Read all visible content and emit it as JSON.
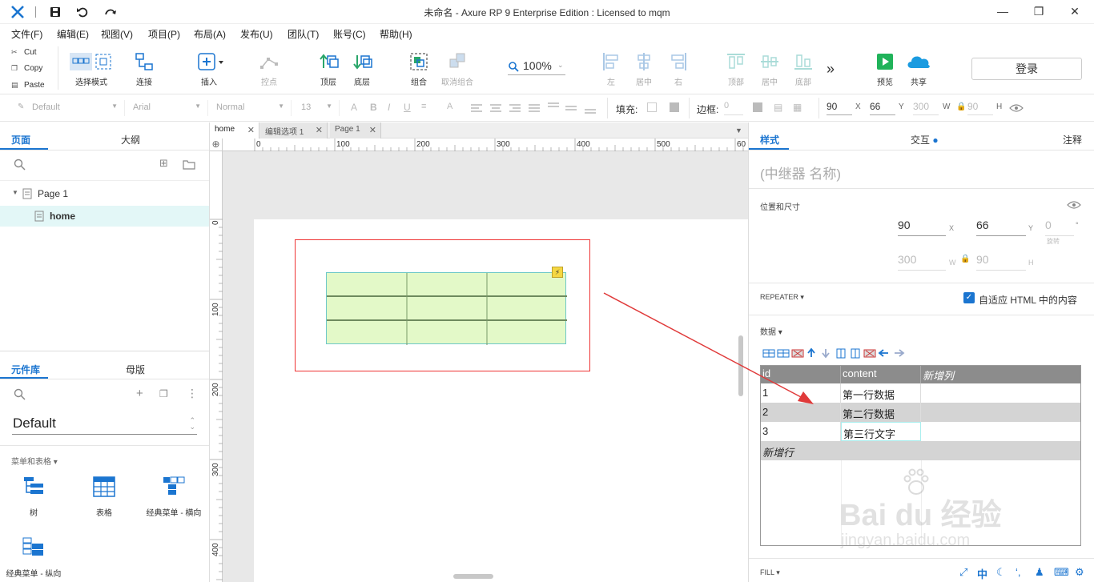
{
  "window": {
    "title": "未命名 - Axure RP 9 Enterprise Edition : Licensed to mqm"
  },
  "menu": [
    "文件(F)",
    "编辑(E)",
    "视图(V)",
    "项目(P)",
    "布局(A)",
    "发布(U)",
    "团队(T)",
    "账号(C)",
    "帮助(H)"
  ],
  "clipboard": {
    "cut": "Cut",
    "copy": "Copy",
    "paste": "Paste"
  },
  "toolbar": {
    "select_mode": "选择模式",
    "connect": "连接",
    "insert": "插入",
    "point": "控点",
    "top": "顶层",
    "bottom": "底层",
    "group": "组合",
    "ungroup": "取消组合",
    "zoom": "100%",
    "align_left": "左",
    "align_center": "居中",
    "align_right": "右",
    "align_top": "顶部",
    "align_middle": "居中",
    "align_bottom": "底部",
    "more": "»",
    "preview": "预览",
    "share": "共享",
    "login": "登录"
  },
  "format": {
    "style": "Default",
    "font": "Arial",
    "weight": "Normal",
    "size": "13",
    "fill_label": "填充:",
    "border_label": "边框:",
    "border_value": "0",
    "x": "90",
    "y": "66",
    "w": "300",
    "h": "90",
    "x_unit": "X",
    "y_unit": "Y",
    "w_unit": "W",
    "h_unit": "H"
  },
  "pages_panel": {
    "tab_pages": "页面",
    "tab_outline": "大纲",
    "page1": "Page 1",
    "home": "home"
  },
  "library_panel": {
    "tab_library": "元件库",
    "tab_masters": "母版",
    "library_select": "Default",
    "section": "菜单和表格",
    "items": [
      "树",
      "表格",
      "经典菜单 - 横向",
      "经典菜单 - 纵向"
    ]
  },
  "doc_tabs": [
    "home",
    "编辑选项 1",
    "Page 1"
  ],
  "ruler": {
    "h_ticks": [
      "0",
      "100",
      "200",
      "300",
      "400",
      "500",
      "60"
    ],
    "v_ticks": [
      "0",
      "100",
      "200",
      "300",
      "400"
    ]
  },
  "right_panel": {
    "tab_style": "样式",
    "tab_interactions": "交互",
    "tab_notes": "注释",
    "name_placeholder": "(中继器 名称)",
    "position_section": "位置和尺寸",
    "x": "90",
    "y": "66",
    "rotation": "0",
    "rotation_label": "旋转",
    "w": "300",
    "h": "90",
    "unit_x": "X",
    "unit_y": "Y",
    "unit_w": "W",
    "unit_h": "H",
    "degree": "°",
    "repeater_section": "REPEATER",
    "fit_html": "自适应 HTML 中的内容",
    "fit_html_checked": true,
    "data_section": "数据",
    "fill_section": "FILL",
    "accent_color": "#1b75d0"
  },
  "repeater_grid": {
    "headers": [
      "id",
      "content",
      "新增列"
    ],
    "rows": [
      [
        "1",
        "第一行数据"
      ],
      [
        "2",
        "第二行数据"
      ],
      [
        "3",
        "第三行文字"
      ]
    ],
    "new_row": "新增行"
  },
  "watermark": {
    "brand": "Bai du 经验",
    "url": "jingyan.baidu.com"
  },
  "bottom_icons": [
    "中"
  ]
}
